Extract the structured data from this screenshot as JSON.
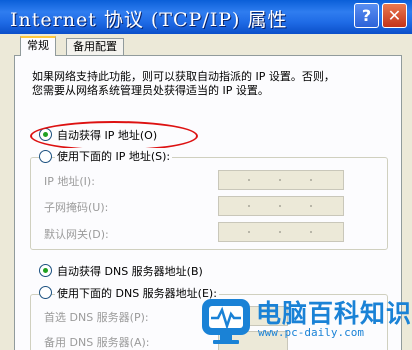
{
  "window": {
    "title": "Internet 协议 (TCP/IP) 属性",
    "help_glyph": "?",
    "close_glyph": "✕"
  },
  "tabs": [
    "常规",
    "备用配置"
  ],
  "description": [
    "如果网络支持此功能，则可以获取自动指派的 IP 设置。否则，",
    "您需要从网络系统管理员处获得适当的 IP 设置。"
  ],
  "ip": {
    "auto_label": "自动获得 IP 地址(O)",
    "auto_selected": true,
    "manual_label": "使用下面的 IP 地址(S):",
    "fields": [
      {
        "label": "IP 地址(I):",
        "value": ""
      },
      {
        "label": "子网掩码(U):",
        "value": ""
      },
      {
        "label": "默认网关(D):",
        "value": ""
      }
    ]
  },
  "dns": {
    "auto_label": "自动获得 DNS 服务器地址(B)",
    "auto_selected": true,
    "manual_label": "使用下面的 DNS 服务器地址(E):",
    "fields": [
      {
        "label": "首选 DNS 服务器(P):",
        "value": ""
      },
      {
        "label": "备用 DNS 服务器(A):",
        "value": ""
      }
    ]
  },
  "watermark": {
    "brand": "电脑百科知识",
    "url": "www.pc-daily.com"
  },
  "colors": {
    "titlebar": "#1f6be6",
    "highlight_oval": "#dd1111",
    "watermark": "#1a82d6"
  }
}
